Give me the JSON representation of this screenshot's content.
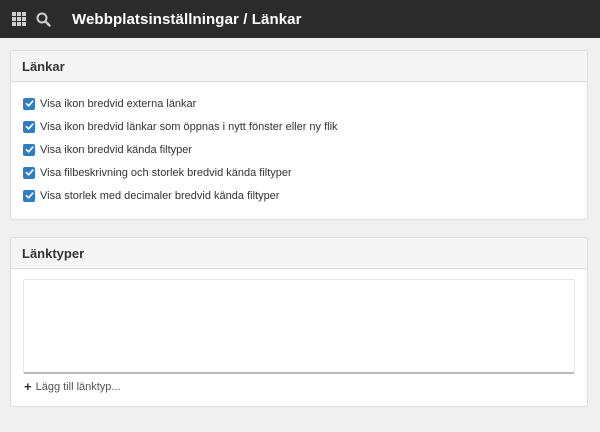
{
  "header": {
    "title": "Webbplatsinställningar / Länkar",
    "apps_icon": "grid-icon",
    "search_icon": "search-icon"
  },
  "links_panel": {
    "title": "Länkar",
    "options": [
      {
        "label": "Visa ikon bredvid externa länkar",
        "checked": true
      },
      {
        "label": "Visa ikon bredvid länkar som öppnas i nytt fönster eller ny flik",
        "checked": true
      },
      {
        "label": "Visa ikon bredvid kända filtyper",
        "checked": true
      },
      {
        "label": "Visa filbeskrivning och storlek bredvid kända filtyper",
        "checked": true
      },
      {
        "label": "Visa storlek med decimaler bredvid kända filtyper",
        "checked": true
      }
    ]
  },
  "linktypes_panel": {
    "title": "Länktyper",
    "add_label": "Lägg till länktyp..."
  },
  "colors": {
    "topbar": "#2b2b2b",
    "checkbox": "#2f7ec2"
  }
}
